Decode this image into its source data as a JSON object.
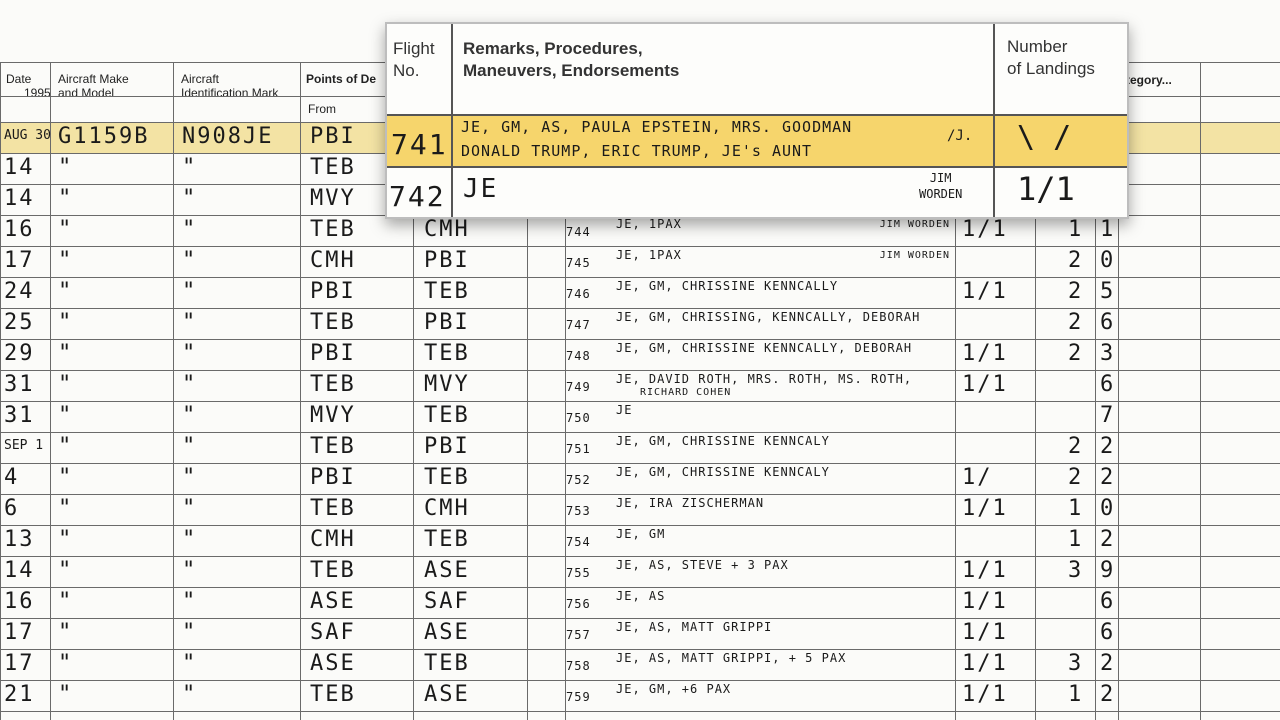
{
  "header": {
    "date_label": "Date",
    "year": "1995",
    "aircraft_make_label": "Aircraft Make\nand Model",
    "aircraft_id_label": "Aircraft\nIdentification Mark",
    "points_label": "Points of De",
    "from_label": "From",
    "category_label": "tegory..."
  },
  "zoom": {
    "flight_label": "Flight\nNo.",
    "remarks_label": "Remarks, Procedures,\nManeuvers, Endorsements",
    "landings_label": "Number\nof Landings",
    "row1": {
      "flight": "741",
      "remarks_line1": "JE, GM, AS, PAULA EPSTEIN, MRS. GOODMAN",
      "remarks_line2": "DONALD TRUMP, ERIC TRUMP, JE's AUNT",
      "note": "/J.",
      "landings": "\\ /"
    },
    "row2": {
      "flight": "742",
      "remarks": "JE",
      "note": "JIM\nWORDEN",
      "landings": "1/1"
    }
  },
  "rows": [
    {
      "date": "AUG 30",
      "make": "G1159B",
      "id": "N908JE",
      "from": "PBI",
      "to": "",
      "flight": "",
      "remarks": "",
      "note": "",
      "land": "",
      "a": "",
      "b": ""
    },
    {
      "date": "14",
      "make": "\"",
      "id": "\"",
      "from": "TEB",
      "to": "",
      "flight": "",
      "remarks": "",
      "note": "",
      "land": "",
      "a": "",
      "b": ""
    },
    {
      "date": "14",
      "make": "\"",
      "id": "\"",
      "from": "MVY",
      "to": "",
      "flight": "",
      "remarks": "",
      "note": "",
      "land": "",
      "a": "",
      "b": ""
    },
    {
      "date": "16",
      "make": "\"",
      "id": "\"",
      "from": "TEB",
      "to": "CMH",
      "flight": "744",
      "remarks": "JE, 1PAX",
      "note": "JIM WORDEN",
      "land": "1/1",
      "a": "1",
      "b": "1"
    },
    {
      "date": "17",
      "make": "\"",
      "id": "\"",
      "from": "CMH",
      "to": "PBI",
      "flight": "745",
      "remarks": "JE, 1PAX",
      "note": "JIM WORDEN",
      "land": "",
      "a": "2",
      "b": "0"
    },
    {
      "date": "24",
      "make": "\"",
      "id": "\"",
      "from": "PBI",
      "to": "TEB",
      "flight": "746",
      "remarks": "JE, GM, CHRISSINE KENNCALLY",
      "note": "",
      "land": "1/1",
      "a": "2",
      "b": "5"
    },
    {
      "date": "25",
      "make": "\"",
      "id": "\"",
      "from": "TEB",
      "to": "PBI",
      "flight": "747",
      "remarks": "JE, GM, CHRISSING, KENNCALLY, DEBORAH",
      "note": "",
      "land": "",
      "a": "2",
      "b": "6"
    },
    {
      "date": "29",
      "make": "\"",
      "id": "\"",
      "from": "PBI",
      "to": "TEB",
      "flight": "748",
      "remarks": "JE, GM, CHRISSINE KENNCALLY, DEBORAH",
      "note": "",
      "land": "1/1",
      "a": "2",
      "b": "3"
    },
    {
      "date": "31",
      "make": "\"",
      "id": "\"",
      "from": "TEB",
      "to": "MVY",
      "flight": "749",
      "remarks": "JE, DAVID ROTH, MRS. ROTH, MS. ROTH,",
      "remarks2": "RICHARD COHEN",
      "note": "",
      "land": "1/1",
      "a": "",
      "b": "6"
    },
    {
      "date": "31",
      "make": "\"",
      "id": "\"",
      "from": "MVY",
      "to": "TEB",
      "flight": "750",
      "remarks": "JE",
      "note": "",
      "land": "",
      "a": "",
      "b": "7"
    },
    {
      "date": "SEP 1",
      "make": "\"",
      "id": "\"",
      "from": "TEB",
      "to": "PBI",
      "flight": "751",
      "remarks": "JE, GM, CHRISSINE KENNCALY",
      "note": "",
      "land": "",
      "a": "2",
      "b": "2"
    },
    {
      "date": "4",
      "make": "\"",
      "id": "\"",
      "from": "PBI",
      "to": "TEB",
      "flight": "752",
      "remarks": "JE, GM, CHRISSINE KENNCALY",
      "note": "",
      "land": "1/",
      "a": "2",
      "b": "2"
    },
    {
      "date": "6",
      "make": "\"",
      "id": "\"",
      "from": "TEB",
      "to": "CMH",
      "flight": "753",
      "remarks": "JE, IRA ZISCHERMAN",
      "note": "",
      "land": "1/1",
      "a": "1",
      "b": "0"
    },
    {
      "date": "13",
      "make": "\"",
      "id": "\"",
      "from": "CMH",
      "to": "TEB",
      "flight": "754",
      "remarks": "JE, GM",
      "note": "",
      "land": "",
      "a": "1",
      "b": "2"
    },
    {
      "date": "14",
      "make": "\"",
      "id": "\"",
      "from": "TEB",
      "to": "ASE",
      "flight": "755",
      "remarks": "JE, AS, STEVE + 3 PAX",
      "note": "",
      "land": "1/1",
      "a": "3",
      "b": "9"
    },
    {
      "date": "16",
      "make": "\"",
      "id": "\"",
      "from": "ASE",
      "to": "SAF",
      "flight": "756",
      "remarks": "JE, AS",
      "note": "",
      "land": "1/1",
      "a": "",
      "b": "6"
    },
    {
      "date": "17",
      "make": "\"",
      "id": "\"",
      "from": "SAF",
      "to": "ASE",
      "flight": "757",
      "remarks": "JE, AS, MATT GRIPPI",
      "note": "",
      "land": "1/1",
      "a": "",
      "b": "6"
    },
    {
      "date": "17",
      "make": "\"",
      "id": "\"",
      "from": "ASE",
      "to": "TEB",
      "flight": "758",
      "remarks": "JE, AS, MATT GRIPPI, + 5 PAX",
      "note": "",
      "land": "1/1",
      "a": "3",
      "b": "2"
    },
    {
      "date": "21",
      "make": "\"",
      "id": "\"",
      "from": "TEB",
      "to": "ASE",
      "flight": "759",
      "remarks": "JE, GM, +6 PAX",
      "note": "",
      "land": "1/1",
      "a": "1",
      "b": "2"
    }
  ]
}
